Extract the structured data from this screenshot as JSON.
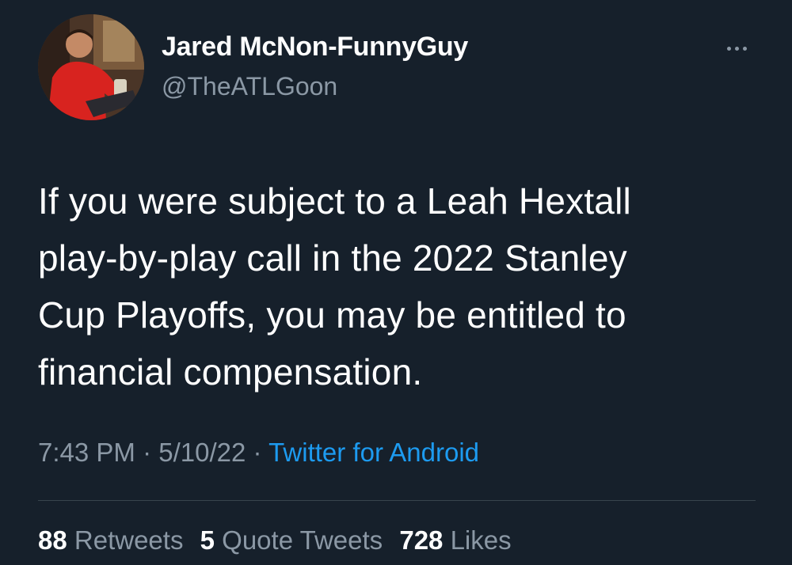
{
  "author": {
    "name": "Jared McNon-FunnyGuy",
    "handle": "@TheATLGoon"
  },
  "tweet": {
    "text_lines": [
      "If you were subject to a Leah Hextall",
      "play-by-play call in the 2022 Stanley",
      "Cup Playoffs, you may be entitled to",
      "financial compensation."
    ]
  },
  "meta": {
    "time": "7:43 PM",
    "separator": " · ",
    "date": "5/10/22",
    "source": "Twitter for Android"
  },
  "stats": {
    "retweets_count": "88",
    "retweets_label": "Retweets",
    "quotes_count": "5",
    "quotes_label": "Quote Tweets",
    "likes_count": "728",
    "likes_label": "Likes"
  },
  "icons": {
    "more": "more-horizontal-icon"
  },
  "colors": {
    "background": "#16202b",
    "text": "#ffffff",
    "secondary": "#8b98a5",
    "link": "#1d9bf0"
  }
}
